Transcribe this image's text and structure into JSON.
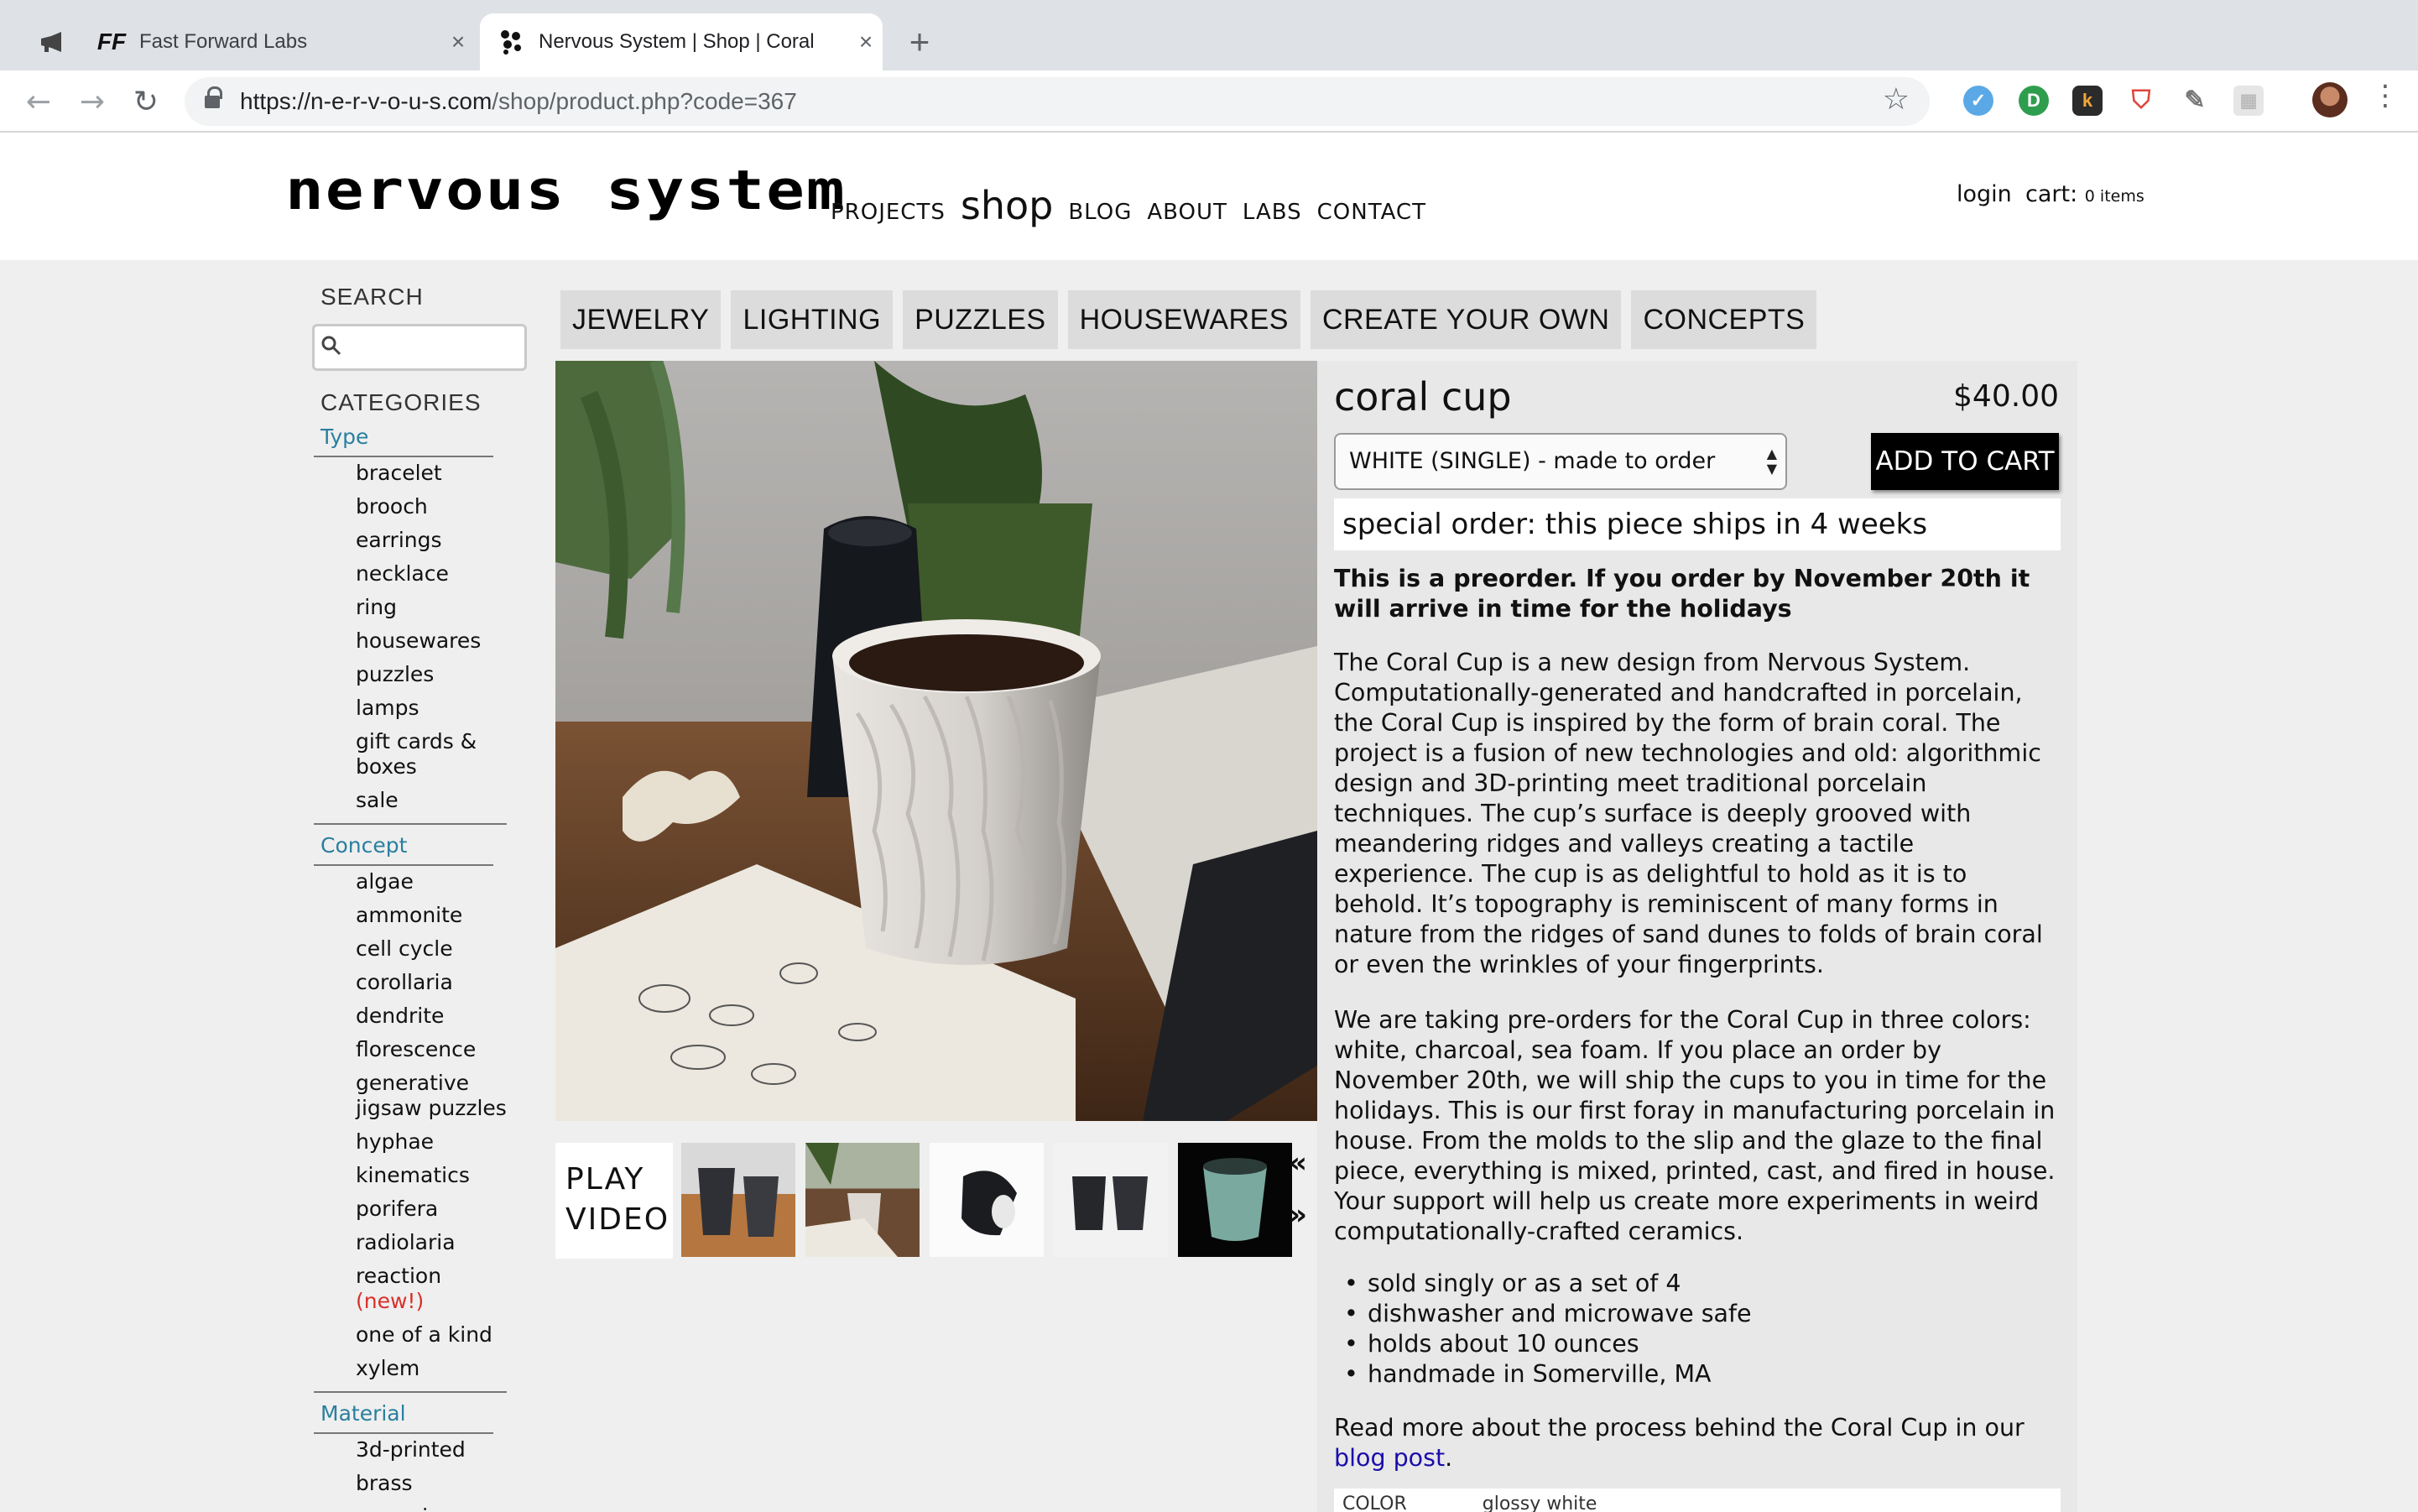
{
  "browser": {
    "tabs": [
      {
        "label": "Fast Forward Labs",
        "icon": "ff-logo-icon"
      },
      {
        "label": "Nervous System | Shop | Coral",
        "icon": "nervous-system-favicon",
        "active": true
      }
    ],
    "url_domain": "https://n-e-r-v-o-u-s.com",
    "url_path": "/shop/product.php?code=367"
  },
  "site": {
    "logo": "nervous system",
    "nav": [
      "PROJECTS",
      "shop",
      "BLOG",
      "ABOUT",
      "LABS",
      "CONTACT"
    ],
    "login": "login",
    "cart_label": "cart:",
    "cart_count": "0 items"
  },
  "sidebar": {
    "search_heading": "SEARCH",
    "categories_heading": "CATEGORIES",
    "groups": [
      {
        "title": "Type",
        "items": [
          "bracelet",
          "brooch",
          "earrings",
          "necklace",
          "ring",
          "housewares",
          "puzzles",
          "lamps",
          "gift cards & boxes",
          "sale"
        ]
      },
      {
        "title": "Concept",
        "items": [
          "algae",
          "ammonite",
          "cell cycle",
          "corollaria",
          "dendrite",
          "florescence",
          "generative jigsaw puzzles",
          "hyphae",
          "kinematics",
          "porifera",
          "radiolaria",
          "reaction",
          "one of a kind",
          "xylem"
        ],
        "new_tag": "(new!)"
      },
      {
        "title": "Material",
        "items": [
          "3d-printed",
          "brass",
          "ceramic"
        ]
      }
    ]
  },
  "category_tabs": [
    "JEWELRY",
    "LIGHTING",
    "PUZZLES",
    "HOUSEWARES",
    "CREATE YOUR OWN",
    "CONCEPTS"
  ],
  "product": {
    "title": "coral cup",
    "price": "$40.00",
    "option_selected": "WHITE (SINGLE) - made to order",
    "add_to_cart": "ADD TO CART",
    "special_order": "special order: this piece ships in 4 weeks",
    "preorder_note": "This is a preorder. If you order by November 20th it will arrive in time for the holidays",
    "description_1": "The Coral Cup is a new design from Nervous System. Computationally-generated and handcrafted in porcelain, the Coral Cup is inspired by the form of brain coral. The project is a fusion of new technologies and old: algorithmic design and 3D-printing meet traditional porcelain techniques. The cup’s surface is deeply grooved with meandering ridges and valleys creating a tactile experience. The cup is as delightful to hold as it is to behold. It’s topography is reminiscent of many forms in nature from the ridges of sand dunes to folds of brain coral or even the wrinkles of your fingerprints.",
    "description_2": "We are taking pre-orders for the Coral Cup in three colors: white, charcoal, sea foam. If you place an order by November 20th, we will ship the cups to you in time for the holidays. This is our first foray in manufacturing porcelain in house. From the molds to the slip and the glaze to the final piece, everything is mixed, printed, cast, and fired in house. Your support will help us create more experiments in weird computationally-crafted ceramics.",
    "bullets": [
      "sold singly or as a set of 4",
      "dishwasher and microwave safe",
      "holds about 10 ounces",
      "handmade in Somerville, MA"
    ],
    "readmore_text": "Read more about the process behind the Coral Cup in our",
    "readmore_link": "blog post",
    "readmore_end": ".",
    "spec_label": "COLOR",
    "spec_value": "glossy white",
    "play_video_line1": "PLAY",
    "play_video_line2": "VIDEO",
    "carousel_prev": "«",
    "carousel_next": "»"
  }
}
